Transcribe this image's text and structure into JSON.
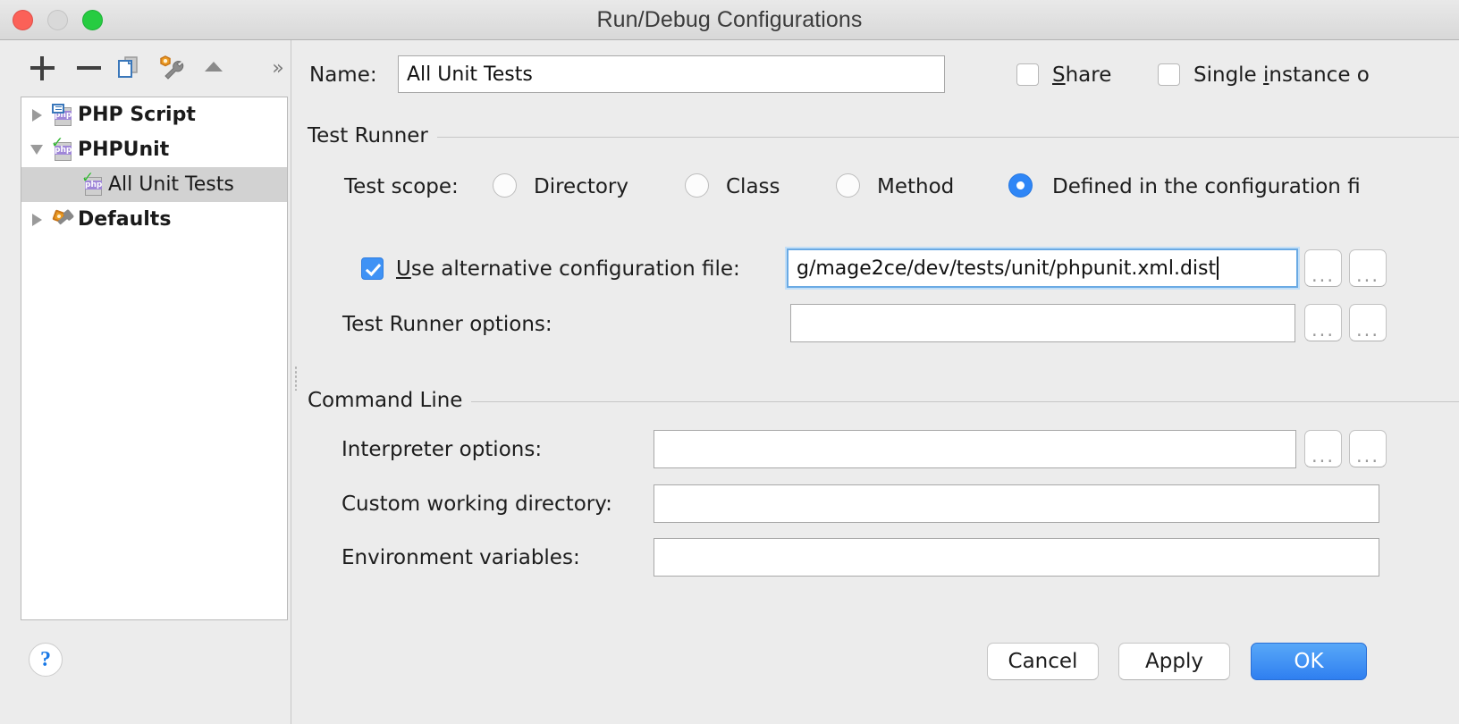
{
  "window": {
    "title": "Run/Debug Configurations",
    "traffic_lights": [
      "close",
      "minimize",
      "maximize"
    ]
  },
  "toolbar": {
    "add_label": "+",
    "remove_label": "−",
    "copy_icon": "copy-configuration-icon",
    "defaults_icon": "edit-defaults-icon",
    "move_up_icon": "move-up-icon",
    "overflow_label": "»"
  },
  "tree": {
    "items": [
      {
        "label": "PHP Script",
        "icon": "php-script-icon",
        "expanded": false,
        "bold": true,
        "selected": false,
        "indent": 0,
        "has_arrow": true
      },
      {
        "label": "PHPUnit",
        "icon": "phpunit-icon",
        "expanded": true,
        "bold": true,
        "selected": false,
        "indent": 0,
        "has_arrow": true
      },
      {
        "label": "All Unit Tests",
        "icon": "phpunit-icon",
        "expanded": null,
        "bold": false,
        "selected": true,
        "indent": 1,
        "has_arrow": false
      },
      {
        "label": "Defaults",
        "icon": "defaults-icon",
        "expanded": false,
        "bold": true,
        "selected": false,
        "indent": 0,
        "has_arrow": true
      }
    ]
  },
  "form": {
    "name_label": "Name:",
    "name_value": "All Unit Tests",
    "share": {
      "label_pre": "",
      "mnemonic": "S",
      "label_post": "hare",
      "checked": false
    },
    "single_instance": {
      "label_pre": "Single ",
      "mnemonic": "i",
      "label_post": "nstance o",
      "checked": false
    },
    "test_runner_section": "Test Runner",
    "test_scope_label": "Test scope:",
    "test_scope_options": [
      {
        "label": "Directory",
        "selected": false
      },
      {
        "label": "Class",
        "selected": false
      },
      {
        "label": "Method",
        "selected": false
      },
      {
        "label": "Defined in the configuration fi",
        "selected": true
      }
    ],
    "alt_config": {
      "mnemonic": "U",
      "label_post": "se alternative configuration file:",
      "checked": true,
      "value": "g/mage2ce/dev/tests/unit/phpunit.xml.dist",
      "focused": true
    },
    "test_runner_options_label": "Test Runner options:",
    "test_runner_options_value": "",
    "command_line_section": "Command Line",
    "interpreter_options_label": "Interpreter options:",
    "interpreter_options_value": "",
    "custom_working_directory_label": "Custom working directory:",
    "custom_working_directory_value": "",
    "environment_variables_label": "Environment variables:",
    "environment_variables_value": "",
    "browse_label": "..."
  },
  "footer": {
    "help_label": "?",
    "cancel_label": "Cancel",
    "apply_label": "Apply",
    "ok_label": "OK"
  },
  "colors": {
    "accent_blue": "#2f86f6",
    "ok_button_blue": "#2f7ff0",
    "window_background": "#ececec",
    "selection_gray": "#d2d2d2",
    "help_blue": "#1878e6"
  }
}
